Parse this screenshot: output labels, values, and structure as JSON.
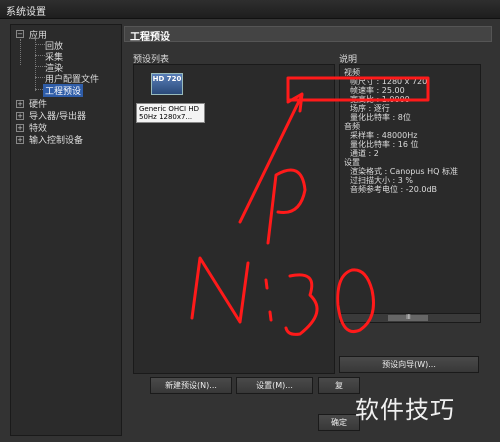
{
  "window": {
    "title": "系统设置"
  },
  "tree": {
    "root_label": "应用",
    "children": [
      "回放",
      "采集",
      "渲染",
      "用户配置文件",
      "工程预设"
    ],
    "selected": "工程预设",
    "others": [
      "硬件",
      "导入器/导出器",
      "特效",
      "输入控制设备"
    ]
  },
  "section": {
    "title": "工程预设"
  },
  "preset_list": {
    "label": "预设列表",
    "items": [
      {
        "icon": "HD 720",
        "name_line1": "Generic OHCI HD",
        "name_line2": "50Hz  1280x7..."
      }
    ]
  },
  "description": {
    "label": "说明",
    "lines": [
      "视频",
      "帧尺寸 : 1280 x 720",
      "帧速率 : 25.00",
      "宽高比 : 1.0000",
      "场序 : 逐行",
      "量化比特率 : 8位",
      "音频",
      "采样率 : 48000Hz",
      "量化比特率 : 16 位",
      "通道 : 2",
      "设置",
      "渲染格式 : Canopus HQ 标准",
      "过扫描大小 : 3 %",
      "音频参考电位 : -20.0dB"
    ]
  },
  "scroll": {
    "thumb_glyph": "Ⅲ"
  },
  "buttons": {
    "preset_wizard": "预设向导(W)...",
    "new_preset": "新建预设(N)...",
    "settings": "设置(M)...",
    "partial": "复",
    "confirm": "确定"
  },
  "watermark": "软件技巧",
  "colors": {
    "annotation": "#ff1a1a",
    "selection": "#2f5da8"
  }
}
